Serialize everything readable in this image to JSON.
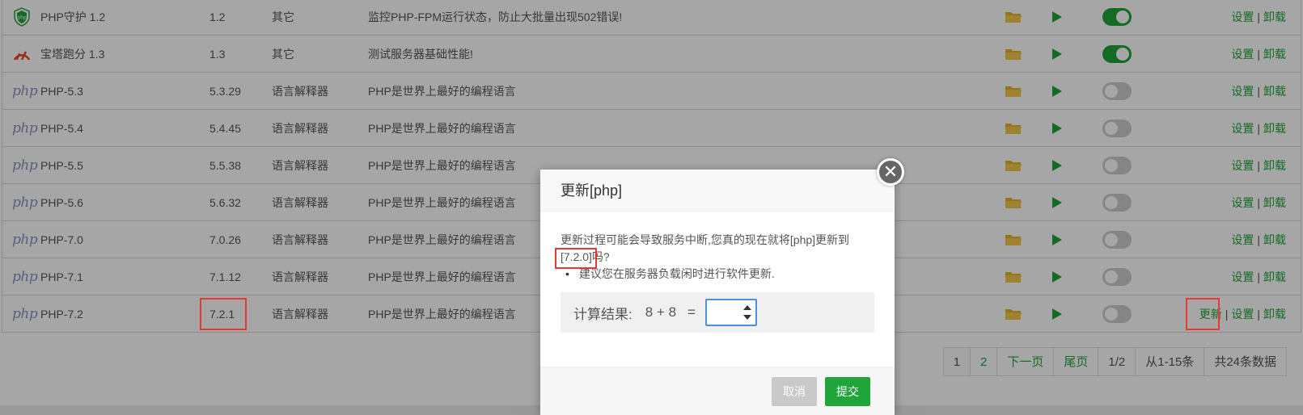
{
  "colors": {
    "accent": "#20a53a",
    "highlight_box": "#e53935",
    "php_logo": "#8892bf"
  },
  "table": {
    "rows": [
      {
        "icon": "shield-php-icon",
        "name": "PHP守护 1.2",
        "version": "1.2",
        "type": "其它",
        "desc": "监控PHP-FPM运行状态，防止大批量出现502错误!",
        "enabled": true,
        "actions": [
          "设置",
          "卸载"
        ]
      },
      {
        "icon": "speedometer-icon",
        "name": "宝塔跑分 1.3",
        "version": "1.3",
        "type": "其它",
        "desc": "测试服务器基础性能!",
        "enabled": true,
        "actions": [
          "设置",
          "卸载"
        ]
      },
      {
        "icon": "php-logo-icon",
        "name": "PHP-5.3",
        "version": "5.3.29",
        "type": "语言解释器",
        "desc": "PHP是世界上最好的编程语言",
        "enabled": false,
        "actions": [
          "设置",
          "卸载"
        ]
      },
      {
        "icon": "php-logo-icon",
        "name": "PHP-5.4",
        "version": "5.4.45",
        "type": "语言解释器",
        "desc": "PHP是世界上最好的编程语言",
        "enabled": false,
        "actions": [
          "设置",
          "卸载"
        ]
      },
      {
        "icon": "php-logo-icon",
        "name": "PHP-5.5",
        "version": "5.5.38",
        "type": "语言解释器",
        "desc": "PHP是世界上最好的编程语言",
        "enabled": false,
        "actions": [
          "设置",
          "卸载"
        ]
      },
      {
        "icon": "php-logo-icon",
        "name": "PHP-5.6",
        "version": "5.6.32",
        "type": "语言解释器",
        "desc": "PHP是世界上最好的编程语言",
        "enabled": false,
        "actions": [
          "设置",
          "卸载"
        ]
      },
      {
        "icon": "php-logo-icon",
        "name": "PHP-7.0",
        "version": "7.0.26",
        "type": "语言解释器",
        "desc": "PHP是世界上最好的编程语言",
        "enabled": false,
        "actions": [
          "设置",
          "卸载"
        ]
      },
      {
        "icon": "php-logo-icon",
        "name": "PHP-7.1",
        "version": "7.1.12",
        "type": "语言解释器",
        "desc": "PHP是世界上最好的编程语言",
        "enabled": false,
        "actions": [
          "设置",
          "卸载"
        ]
      },
      {
        "icon": "php-logo-icon",
        "name": "PHP-7.2",
        "version": "7.2.1",
        "type": "语言解释器",
        "desc": "PHP是世界上最好的编程语言",
        "enabled": false,
        "actions": [
          "更新",
          "设置",
          "卸载"
        ]
      }
    ],
    "php_logo_text": "php"
  },
  "pagination": [
    "1",
    "2",
    "下一页",
    "尾页",
    "1/2",
    "从1-15条",
    "共24条数据"
  ],
  "dialog": {
    "title": "更新[php]",
    "message_before": "更新过程可能会导致服务中断,您真的现在就将[php]更新到",
    "target_version": "[7.2.0]",
    "message_after": "吗?",
    "tip": "建议您在服务器负载闲时进行软件更新.",
    "calc_label": "计算结果:",
    "calc_expr": "8 + 8",
    "calc_eq": "=",
    "input_value": "",
    "cancel_label": "取消",
    "submit_label": "提交",
    "close_glyph": "✕"
  }
}
